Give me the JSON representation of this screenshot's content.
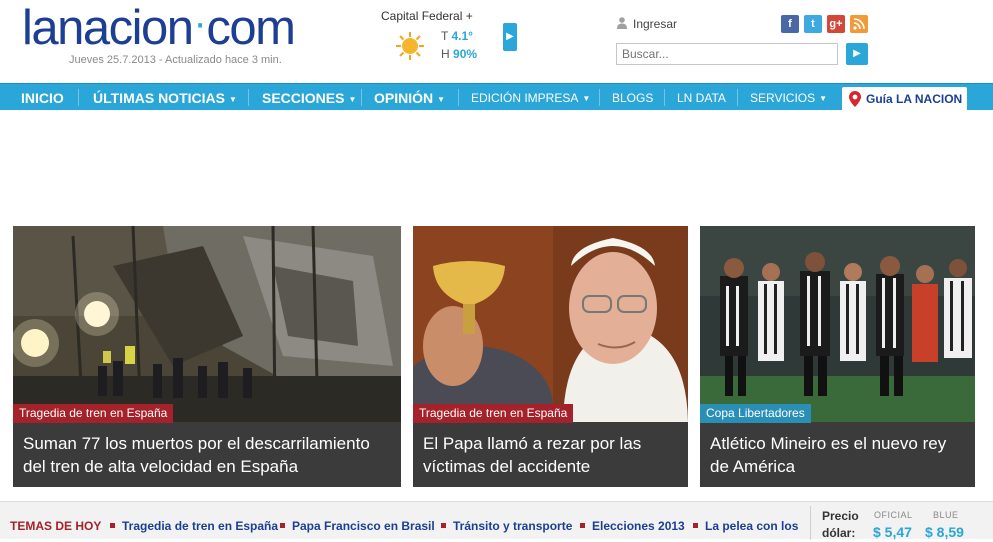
{
  "header": {
    "logo_main": "lanacion",
    "logo_dot": "·",
    "logo_tld": "com",
    "dateline": "Jueves 25.7.2013 - Actualizado hace 3 min."
  },
  "weather": {
    "city": "Capital Federal +",
    "temp_label": "T",
    "temp_value": "4.1°",
    "humidity_label": "H",
    "humidity_value": "90%",
    "icon": "sun-icon"
  },
  "account": {
    "login_label": "Ingresar"
  },
  "social": {
    "facebook": "f",
    "twitter": "t",
    "googleplus": "g+",
    "rss": "rss"
  },
  "search": {
    "placeholder": "Buscar..."
  },
  "nav": {
    "items": [
      {
        "label": "INICIO"
      },
      {
        "label": "ÚLTIMAS NOTICIAS"
      },
      {
        "label": "SECCIONES"
      },
      {
        "label": "OPINIÓN"
      },
      {
        "label": "EDICIÓN IMPRESA"
      },
      {
        "label": "BLOGS"
      },
      {
        "label": "LN DATA"
      },
      {
        "label": "SERVICIOS"
      }
    ],
    "guia": "Guía LA NACION",
    "colors": {
      "bar": "#2aa6d8",
      "brand": "#1c3f94",
      "accent_red": "#a5222a"
    }
  },
  "cards": [
    {
      "kicker": "Tragedia de tren en España",
      "headline_line1": "Suman 77 los muertos por el descarrilamiento",
      "headline_line2": "del tren de alta velocidad en España"
    },
    {
      "kicker": "Tragedia de tren en España",
      "headline_line1": "El Papa llamó a rezar por las",
      "headline_line2": "víctimas del accidente"
    },
    {
      "kicker": "Copa Libertadores",
      "headline_line1": "Atlético Mineiro es el nuevo rey",
      "headline_line2": "de América"
    }
  ],
  "temas": {
    "label": "TEMAS DE HOY",
    "items": [
      "Tragedia de tren en España",
      "Papa Francisco en Brasil",
      "Tránsito y transporte",
      "Elecciones 2013",
      "La pelea con los"
    ]
  },
  "dolar": {
    "label_line1": "Precio",
    "label_line2": "dólar:",
    "oficial_label": "OFICIAL",
    "oficial_value": "$ 5,47",
    "blue_label": "BLUE",
    "blue_value": "$ 8,59"
  }
}
